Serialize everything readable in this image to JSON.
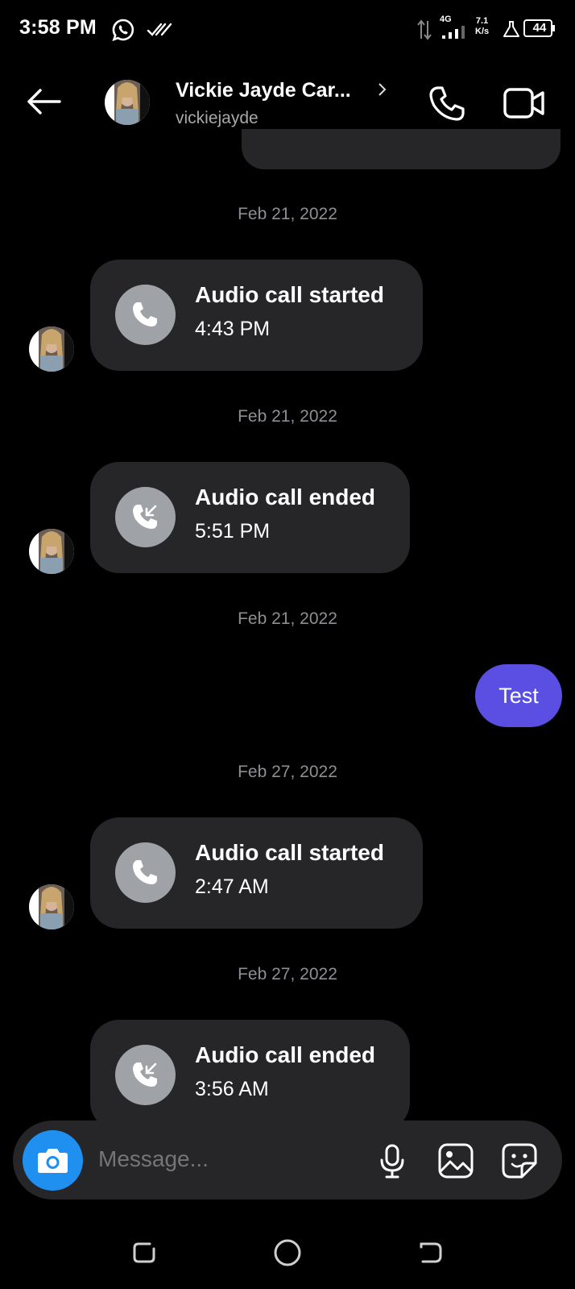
{
  "status_bar": {
    "time": "3:58 PM",
    "network_type": "4G",
    "speed_value": "7.1",
    "speed_unit": "K/s",
    "battery": "44",
    "icons": [
      "whatsapp-icon",
      "double-tick-icon",
      "data-arrows-icon",
      "signal-icon",
      "flask-icon",
      "battery-icon"
    ]
  },
  "header": {
    "contact_name": "Vickie Jayde Car...",
    "handle": "vickiejayde",
    "icons": [
      "back-arrow-icon",
      "chevron-right-icon",
      "phone-icon",
      "video-camera-icon"
    ]
  },
  "thread": {
    "items": [
      {
        "type": "date",
        "text": "Feb 21, 2022"
      },
      {
        "type": "call",
        "title": "Audio call started",
        "time": "4:43 PM",
        "icon": "phone-icon"
      },
      {
        "type": "date",
        "text": "Feb 21, 2022"
      },
      {
        "type": "call",
        "title": "Audio call ended",
        "time": "5:51 PM",
        "icon": "phone-incoming-icon"
      },
      {
        "type": "date",
        "text": "Feb 21, 2022"
      },
      {
        "type": "sent",
        "text": "Test"
      },
      {
        "type": "date",
        "text": "Feb 27, 2022"
      },
      {
        "type": "call",
        "title": "Audio call started",
        "time": "2:47 AM",
        "icon": "phone-icon"
      },
      {
        "type": "date",
        "text": "Feb 27, 2022"
      },
      {
        "type": "call",
        "title": "Audio call ended",
        "time": "3:56 AM",
        "icon": "phone-incoming-icon"
      }
    ]
  },
  "composer": {
    "placeholder": "Message...",
    "icons": [
      "camera-icon",
      "microphone-icon",
      "gallery-icon",
      "sticker-icon"
    ]
  },
  "colors": {
    "background": "#000000",
    "bubble": "#262628",
    "sent_bubble": "#5a4ee3",
    "camera_button": "#1f8ff0",
    "call_icon_circle": "#9fa3a8",
    "muted_text": "#8e8e93"
  }
}
